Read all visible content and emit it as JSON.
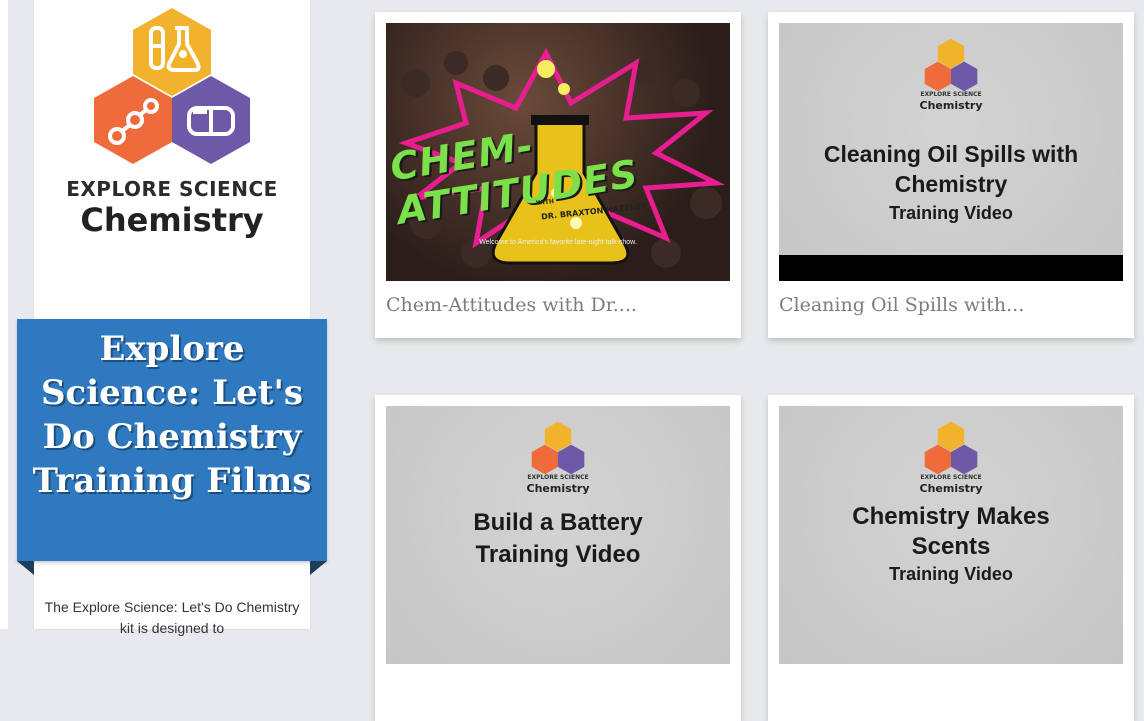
{
  "sidebar": {
    "logo": {
      "line1": "EXPLORE SCIENCE",
      "line2": "Chemistry",
      "colors": {
        "yellow": "#f0b32b",
        "orange": "#f06b3c",
        "purple": "#6e59a8"
      },
      "icons": [
        "flask-icon",
        "molecule-icon",
        "vr-goggles-icon"
      ]
    },
    "banner": {
      "title": "Explore Science: Let's Do Chemistry Training Films",
      "color": "#2f79c0"
    },
    "description": "The Explore Science: Let's Do Chemistry kit is designed to"
  },
  "videos": [
    {
      "title": "Chem-Attitudes with Dr....",
      "thumb": {
        "type": "photo",
        "show_title": "CHEM-ATTITUDES",
        "with_label": "WITH",
        "host": "DR. BRAXTON HAZELBY",
        "caption": "Welcome to America's favorite late-night talk-show."
      }
    },
    {
      "title": "Cleaning Oil Spills with...",
      "thumb": {
        "type": "title-card",
        "logo_line1": "EXPLORE SCIENCE",
        "logo_line2": "Chemistry",
        "heading": "Cleaning Oil Spills with Chemistry",
        "subheading": "Training Video"
      }
    },
    {
      "title": "",
      "thumb": {
        "type": "title-card",
        "logo_line1": "EXPLORE SCIENCE",
        "logo_line2": "Chemistry",
        "heading": "Build a Battery",
        "subheading": "Training Video"
      }
    },
    {
      "title": "",
      "thumb": {
        "type": "title-card",
        "logo_line1": "EXPLORE SCIENCE",
        "logo_line2": "Chemistry",
        "heading": "Chemistry Makes Scents",
        "subheading": "Training Video"
      }
    }
  ]
}
